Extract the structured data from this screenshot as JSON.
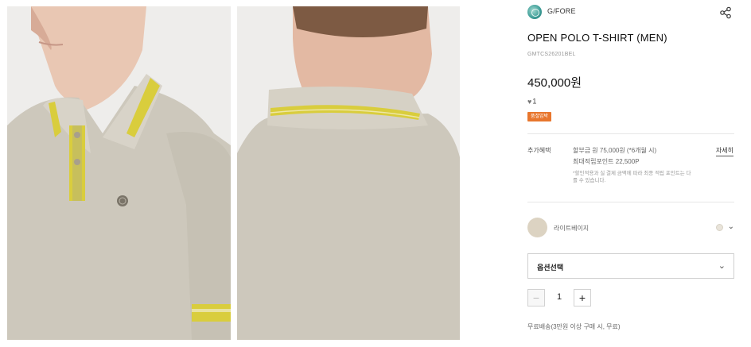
{
  "product_images": [
    {
      "view": "front"
    },
    {
      "view": "back"
    }
  ],
  "brand": {
    "name": "G/FORE",
    "logo_icon": "brand-logo-icon"
  },
  "share_icon": "share-icon",
  "product": {
    "title": "OPEN POLO T-SHIRT (MEN)",
    "sku": "GMTCS26201BEL",
    "price": "450,000원",
    "likes": "1",
    "badge": "품절임박"
  },
  "benefits": {
    "label": "추가혜택",
    "installment": "할부금 원 75,000원 (*6개월 시)",
    "points": "최대적립포인트 22,500P",
    "note": "*할인적용과 실 결제 금액에 따라 최종 적립 포인트는 다를 수 있습니다.",
    "detail_link": "자세히"
  },
  "color": {
    "name": "라이트베이지",
    "swatch": "#dcd3c2"
  },
  "option": {
    "placeholder": "옵션선택"
  },
  "quantity": {
    "minus": "−",
    "value": "1",
    "plus": "+"
  },
  "shipping": "무료배송(3만원 이상 구매 시, 무료)",
  "colors": {
    "accent": "#e8762d",
    "fabric": "#cdc8bc",
    "stripe": "#d9cd3d"
  }
}
